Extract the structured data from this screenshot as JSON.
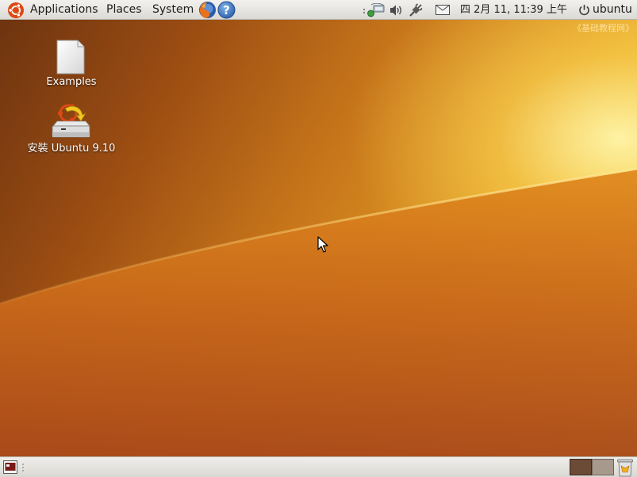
{
  "top_panel": {
    "menus": {
      "applications": "Applications",
      "places": "Places",
      "system": "System"
    },
    "launchers": {
      "browser_icon": "firefox-icon",
      "help_icon": "help-icon",
      "help_glyph": "?"
    },
    "tray": {
      "clock": "四  2月 11, 11:39 上午",
      "user": "ubuntu"
    }
  },
  "desktop": {
    "icons": [
      {
        "label": "Examples",
        "icon": "document-icon"
      },
      {
        "label": "安裝 Ubuntu 9.10",
        "icon": "install-drive-icon"
      }
    ],
    "watermark": "《基础教程网》"
  },
  "bottom_panel": {
    "workspaces": 2,
    "active_workspace": 1
  },
  "colors": {
    "panel": "#dcdad5",
    "wallpaper_dark": "#6e3410",
    "wallpaper_light": "#f7d95a",
    "workspace_active": "#6b4a36",
    "workspace_inactive": "#a8998d"
  }
}
